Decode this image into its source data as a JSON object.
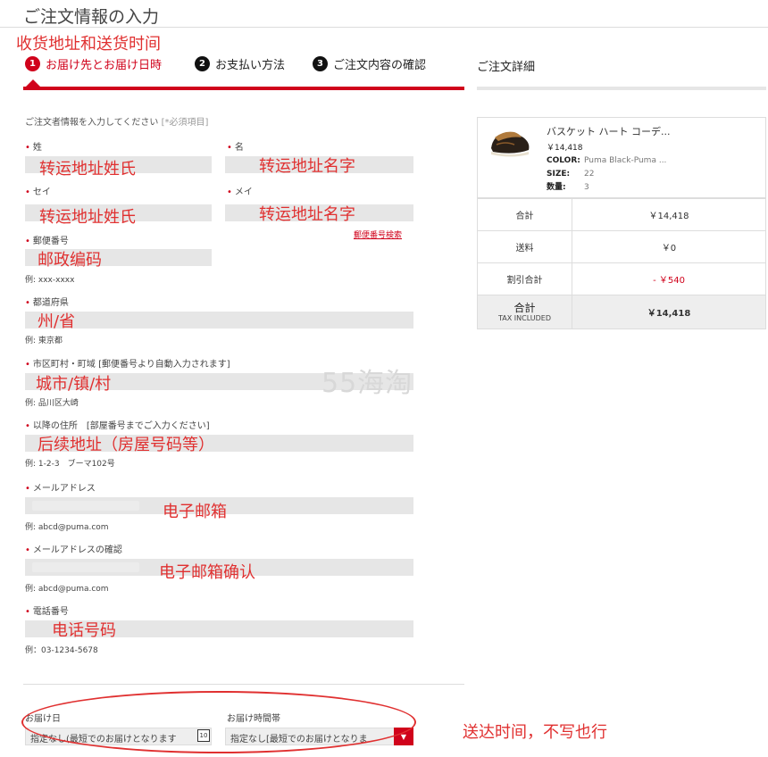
{
  "page": {
    "title": "ご注文情報の入力"
  },
  "annotations": {
    "address_time": "收货地址和送货时间",
    "last_name": "转运地址姓氏",
    "first_name": "转运地址名字",
    "last_name_kana": "转运地址姓氏",
    "first_name_kana": "转运地址名字",
    "postal": "邮政编码",
    "prefecture": "州/省",
    "city": "城市/镇/村",
    "address2": "后续地址（房屋号码等）",
    "email": "电子邮箱",
    "email_confirm": "电子邮箱确认",
    "phone": "电话号码",
    "delivery": "送达时间，不写也行"
  },
  "steps": [
    {
      "num": "1",
      "label": "お届け先とお届け日時"
    },
    {
      "num": "2",
      "label": "お支払い方法"
    },
    {
      "num": "3",
      "label": "ご注文内容の確認"
    }
  ],
  "summary": {
    "title": "ご注文詳細",
    "product": {
      "name": "バスケット ハート コーデ...",
      "price": "￥14,418",
      "color_label": "COLOR:",
      "color_value": "Puma Black-Puma ...",
      "size_label": "SIZE:",
      "size_value": "22",
      "qty_label": "数量:",
      "qty_value": "3"
    },
    "rows": [
      {
        "label": "合計",
        "value": "￥14,418"
      },
      {
        "label": "送料",
        "value": "￥0"
      },
      {
        "label": "割引合計",
        "value": "- ￥540"
      }
    ],
    "total_label": "合計",
    "total_sub": "TAX INCLUDED",
    "total_value": "￥14,418"
  },
  "form": {
    "hint": "ご注文者情報を入力してください",
    "required_note": "[*必須項目]",
    "last_name_label": "姓",
    "first_name_label": "名",
    "last_kana_label": "セイ",
    "first_kana_label": "メイ",
    "postal_label": "郵便番号",
    "postal_search": "郵便番号検索",
    "postal_example": "例: xxx-xxxx",
    "prefecture_label": "都道府県",
    "prefecture_example": "例: 東京都",
    "city_label": "市区町村・町域 [郵便番号より自動入力されます]",
    "city_example": "例: 品川区大崎",
    "address_label": "以降の住所　[部屋番号までご入力ください]",
    "address_example": "例: 1-2-3　ブーマ102号",
    "email_label": "メールアドレス",
    "email_example": "例: abcd@puma.com",
    "email_confirm_label": "メールアドレスの確認",
    "email_confirm_example": "例: abcd@puma.com",
    "phone_label": "電話番号",
    "phone_example": "例：03-1234-5678"
  },
  "delivery": {
    "date_label": "お届け日",
    "date_value": "指定なし(最短でのお届けとなります",
    "date_icon_text": "10",
    "time_label": "お届け時間帯",
    "time_value": "指定なし[最短でのお届けとなりま"
  },
  "watermark": "55海淘",
  "colors": {
    "accent": "#d0021b",
    "annotation": "#e03030",
    "field": "#e6e6e6"
  }
}
